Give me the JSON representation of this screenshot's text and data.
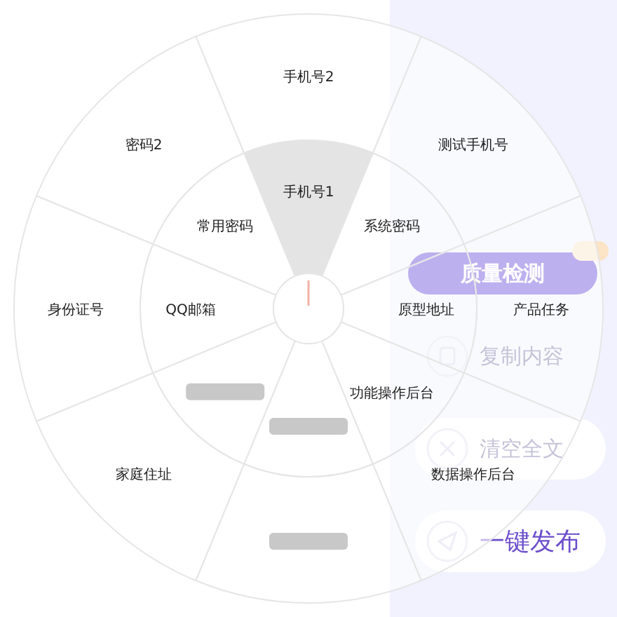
{
  "side_panel": {
    "check_button": {
      "label": "质量检测"
    },
    "actions": [
      {
        "label": "复制内容",
        "kind": "plain"
      },
      {
        "label": "清空全文",
        "kind": "card"
      },
      {
        "label": "一键发布",
        "kind": "primary"
      }
    ]
  },
  "wheel": {
    "outer": [
      {
        "label": "手机号2",
        "kind": "text",
        "selected": false
      },
      {
        "label": "测试手机号",
        "kind": "text",
        "selected": false
      },
      {
        "label": "产品任务",
        "kind": "text",
        "selected": false
      },
      {
        "label": "数据操作后台",
        "kind": "text",
        "selected": false
      },
      {
        "kind": "redacted",
        "selected": false
      },
      {
        "label": "家庭住址",
        "kind": "text",
        "selected": false
      },
      {
        "label": "身份证号",
        "kind": "text",
        "selected": false
      },
      {
        "label": "密码2",
        "kind": "text",
        "selected": false
      }
    ],
    "inner": [
      {
        "label": "手机号1",
        "kind": "text",
        "selected": true
      },
      {
        "label": "系统密码",
        "kind": "text",
        "selected": false
      },
      {
        "label": "原型地址",
        "kind": "text",
        "selected": false
      },
      {
        "label": "功能操作后台",
        "kind": "text",
        "selected": false
      },
      {
        "kind": "redacted",
        "selected": false
      },
      {
        "kind": "redacted",
        "selected": false
      },
      {
        "label": "QQ邮箱",
        "kind": "text",
        "selected": false
      },
      {
        "label": "常用密码",
        "kind": "text",
        "selected": false
      }
    ]
  }
}
